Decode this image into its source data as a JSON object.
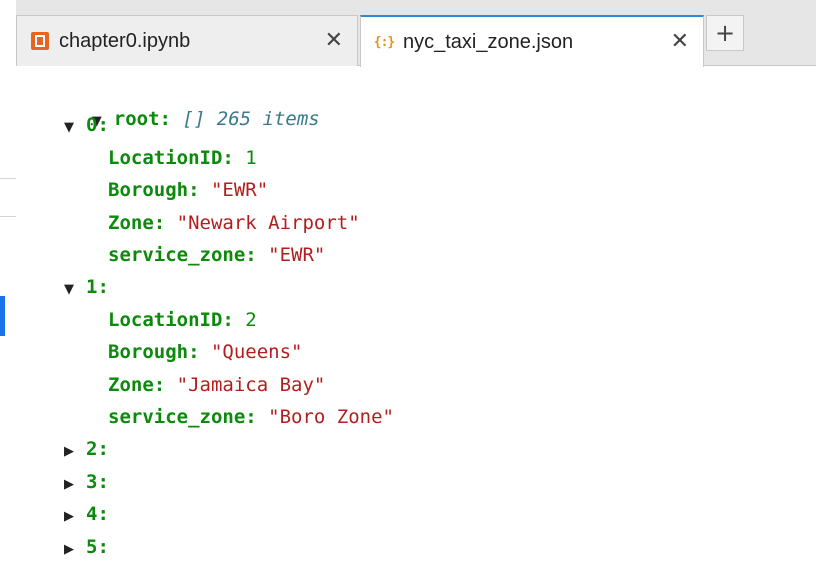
{
  "tabs": [
    {
      "label": "chapter0.ipynb",
      "icon": "notebook-icon",
      "active": false
    },
    {
      "label": "nyc_taxi_zone.json",
      "icon": "json-file-icon",
      "active": true
    }
  ],
  "tab_close_glyph": "✕",
  "add_tab_glyph": "+",
  "tree": {
    "root_key": "root",
    "root_type": "[]",
    "root_count": "265 items",
    "expanded_glyph": "▼",
    "collapsed_glyph": "▶",
    "items": [
      {
        "index": "0",
        "fields": [
          {
            "key": "LocationID",
            "value": "1",
            "kind": "number"
          },
          {
            "key": "Borough",
            "value": "\"EWR\"",
            "kind": "string"
          },
          {
            "key": "Zone",
            "value": "\"Newark Airport\"",
            "kind": "string"
          },
          {
            "key": "service_zone",
            "value": "\"EWR\"",
            "kind": "string"
          }
        ]
      },
      {
        "index": "1",
        "fields": [
          {
            "key": "LocationID",
            "value": "2",
            "kind": "number"
          },
          {
            "key": "Borough",
            "value": "\"Queens\"",
            "kind": "string"
          },
          {
            "key": "Zone",
            "value": "\"Jamaica Bay\"",
            "kind": "string"
          },
          {
            "key": "service_zone",
            "value": "\"Boro Zone\"",
            "kind": "string"
          }
        ]
      },
      {
        "index": "2",
        "fields": []
      },
      {
        "index": "3",
        "fields": []
      },
      {
        "index": "4",
        "fields": []
      },
      {
        "index": "5",
        "fields": []
      }
    ]
  },
  "colors": {
    "key": "#0b8a0b",
    "string": "#b21e1e",
    "meta": "#3b7a8c",
    "accent": "#2b8ad8"
  }
}
